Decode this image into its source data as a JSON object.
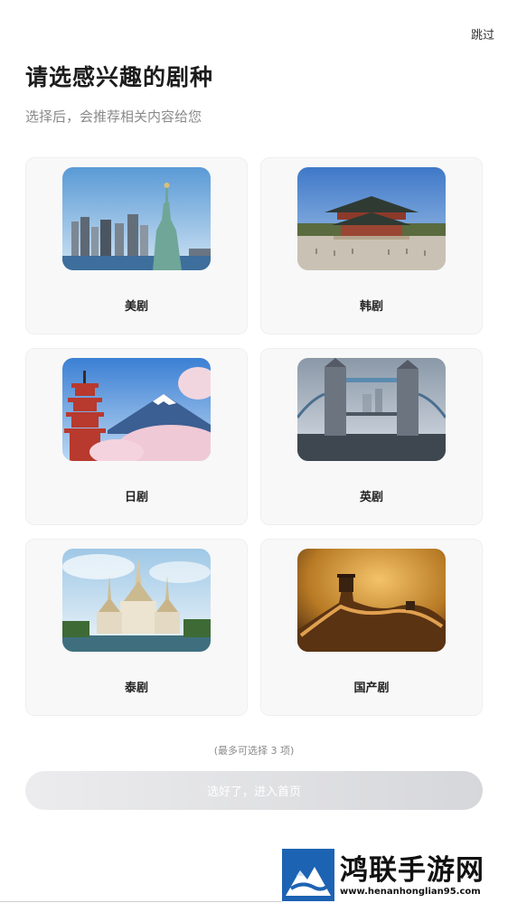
{
  "header": {
    "skip_label": "跳过",
    "title": "请选感兴趣的剧种",
    "subtitle": "选择后，会推荐相关内容给您"
  },
  "genres": [
    {
      "label": "美剧",
      "image": "statue-of-liberty-image"
    },
    {
      "label": "韩剧",
      "image": "korean-palace-image"
    },
    {
      "label": "日剧",
      "image": "mount-fuji-pagoda-image"
    },
    {
      "label": "英剧",
      "image": "tower-bridge-image"
    },
    {
      "label": "泰剧",
      "image": "thai-temple-image"
    },
    {
      "label": "国产剧",
      "image": "great-wall-image"
    }
  ],
  "footer": {
    "hint": "(最多可选择 3 项)",
    "confirm_label": "选好了，进入首页"
  },
  "watermark": {
    "text": "鸿联手游网",
    "url": "www.henanhonglian95.com"
  }
}
